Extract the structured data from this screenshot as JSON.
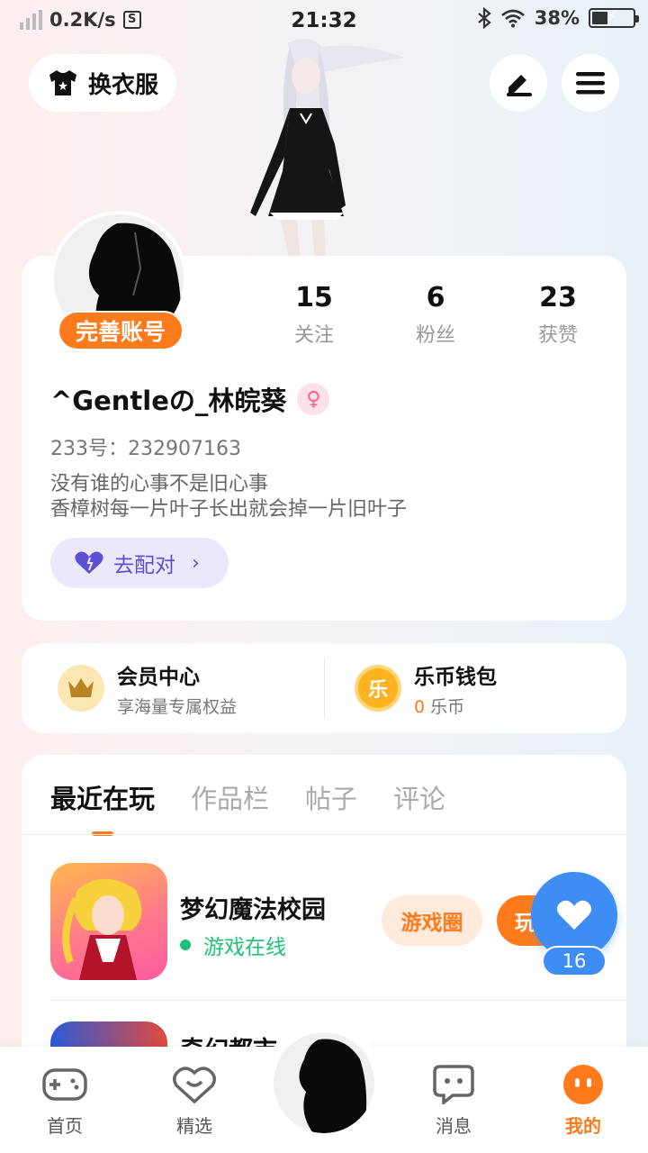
{
  "status_bar": {
    "speed": "0.2K/s",
    "speed_badge": "S",
    "time": "21:32",
    "battery_pct": "38%",
    "battery_level": 0.38
  },
  "top": {
    "dress_label": "换衣服"
  },
  "profile": {
    "perfect_label": "完善账号",
    "stats": [
      {
        "value": "15",
        "label": "关注"
      },
      {
        "value": "6",
        "label": "粉丝"
      },
      {
        "value": "23",
        "label": "获赞"
      }
    ],
    "username": "^Gentleの_林皖葵",
    "uid": "233号：232907163",
    "bio_line1": "没有谁的心事不是旧心事",
    "bio_line2": "香樟树每一片叶子长出就会掉一片旧叶子",
    "match_label": "去配对"
  },
  "wallet": {
    "vip_title": "会员中心",
    "vip_sub": "享海量专属权益",
    "coin_icon_text": "乐",
    "coin_title": "乐币钱包",
    "coin_amount": "0",
    "coin_unit": " 乐币"
  },
  "tabs": [
    "最近在玩",
    "作品栏",
    "帖子",
    "评论"
  ],
  "games": [
    {
      "name": "梦幻魔法校园",
      "status": "游戏在线",
      "circle_label": "游戏圈",
      "play_label": "玩"
    },
    {
      "name": "奇幻都市"
    }
  ],
  "like": {
    "count": "16"
  },
  "nav": [
    {
      "label": "首页"
    },
    {
      "label": "精选"
    },
    {
      "label": "消息"
    },
    {
      "label": "我的"
    }
  ],
  "colors": {
    "accent": "#ff7a1a",
    "like_blue": "#3d8df5",
    "online_green": "#1ec07a",
    "match_purple": "#5b4fd6"
  }
}
